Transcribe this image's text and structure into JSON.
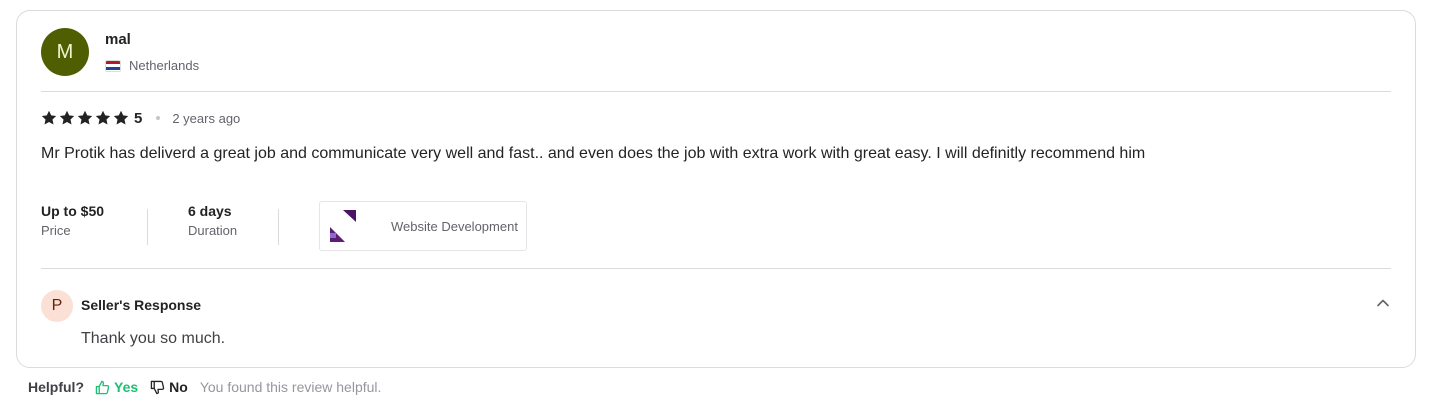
{
  "reviewer": {
    "initial": "M",
    "name": "mal",
    "country": "Netherlands",
    "avatar_color": "#4e5e00"
  },
  "rating": {
    "stars": 5,
    "value": "5",
    "time_ago": "2 years ago"
  },
  "review_text": "Mr Protik has deliverd a great job and communicate very well and fast.. and even does the job with extra work with great easy. I will definitly recommend him",
  "meta": {
    "price_value": "Up to $50",
    "price_label": "Price",
    "duration_value": "6 days",
    "duration_label": "Duration"
  },
  "gig": {
    "title": "Website Development"
  },
  "seller_response": {
    "initial": "P",
    "title": "Seller's Response",
    "text": "Thank you so much."
  },
  "helpful": {
    "label": "Helpful?",
    "yes_label": "Yes",
    "no_label": "No",
    "status": "You found this review helpful."
  },
  "colors": {
    "yes_green": "#1dbf73",
    "star": "#222325"
  }
}
